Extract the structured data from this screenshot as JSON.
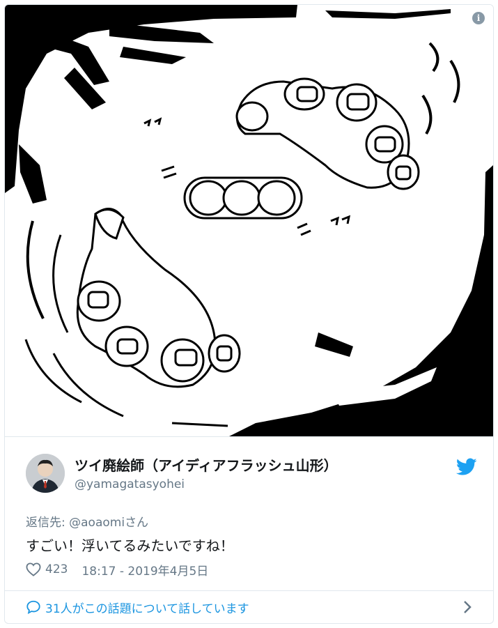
{
  "media": {
    "info_glyph": "i",
    "alt_icon": "info-icon"
  },
  "tweet": {
    "author": {
      "display_name": "ツイ廃絵師（アイディアフラッシュ山形）",
      "handle": "@yamagatasyohei"
    },
    "reply_prefix": "返信先: ",
    "reply_mention": "@aoaomi",
    "reply_suffix": "さん",
    "text": "すごい！浮いてるみたいですね！",
    "like_count": "423",
    "timestamp": "18:17 - 2019年4月5日",
    "conversation_text": "31人がこの話題について話しています"
  },
  "colors": {
    "accent": "#1da1f2",
    "link": "#1b95e0",
    "secondary_text": "#657786",
    "border": "#e1e8ed"
  },
  "icons": [
    "info-icon",
    "twitter-bird-icon",
    "heart-icon",
    "speech-bubble-icon",
    "chevron-right-icon"
  ]
}
